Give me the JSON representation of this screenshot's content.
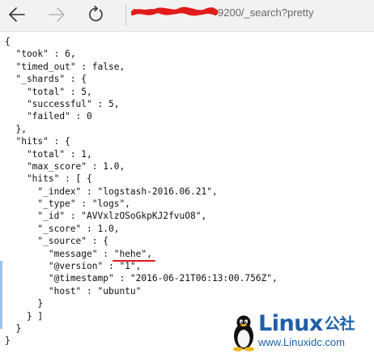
{
  "browser": {
    "address_suffix": "9200/_search?pretty",
    "icons": [
      "arrow-left-icon",
      "arrow-right-icon",
      "refresh-icon"
    ]
  },
  "json_lines": [
    "{",
    "  \"took\" : 6,",
    "  \"timed_out\" : false,",
    "  \"_shards\" : {",
    "    \"total\" : 5,",
    "    \"successful\" : 5,",
    "    \"failed\" : 0",
    "  },",
    "  \"hits\" : {",
    "    \"total\" : 1,",
    "    \"max_score\" : 1.0,",
    "    \"hits\" : [ {",
    "      \"_index\" : \"logstash-2016.06.21\",",
    "      \"_type\" : \"logs\",",
    "      \"_id\" : \"AVVxlzOSoGkpKJ2fvuO8\",",
    "      \"_score\" : 1.0,",
    "      \"_source\" : {",
    "        \"message\" : ",
    "        \"@version\" : \"1\",",
    "        \"@timestamp\" : \"2016-06-21T06:13:00.756Z\",",
    "        \"host\" : \"ubuntu\"",
    "      }",
    "    } ]",
    "  }",
    "}"
  ],
  "highlight": {
    "line_index": 17,
    "text": "\"hehe\",",
    "color": "#e01818"
  },
  "watermark": {
    "title": "Linux",
    "title_cn": "公社",
    "url": "www.Linuxidc.com",
    "color": "#1d5fa8"
  }
}
